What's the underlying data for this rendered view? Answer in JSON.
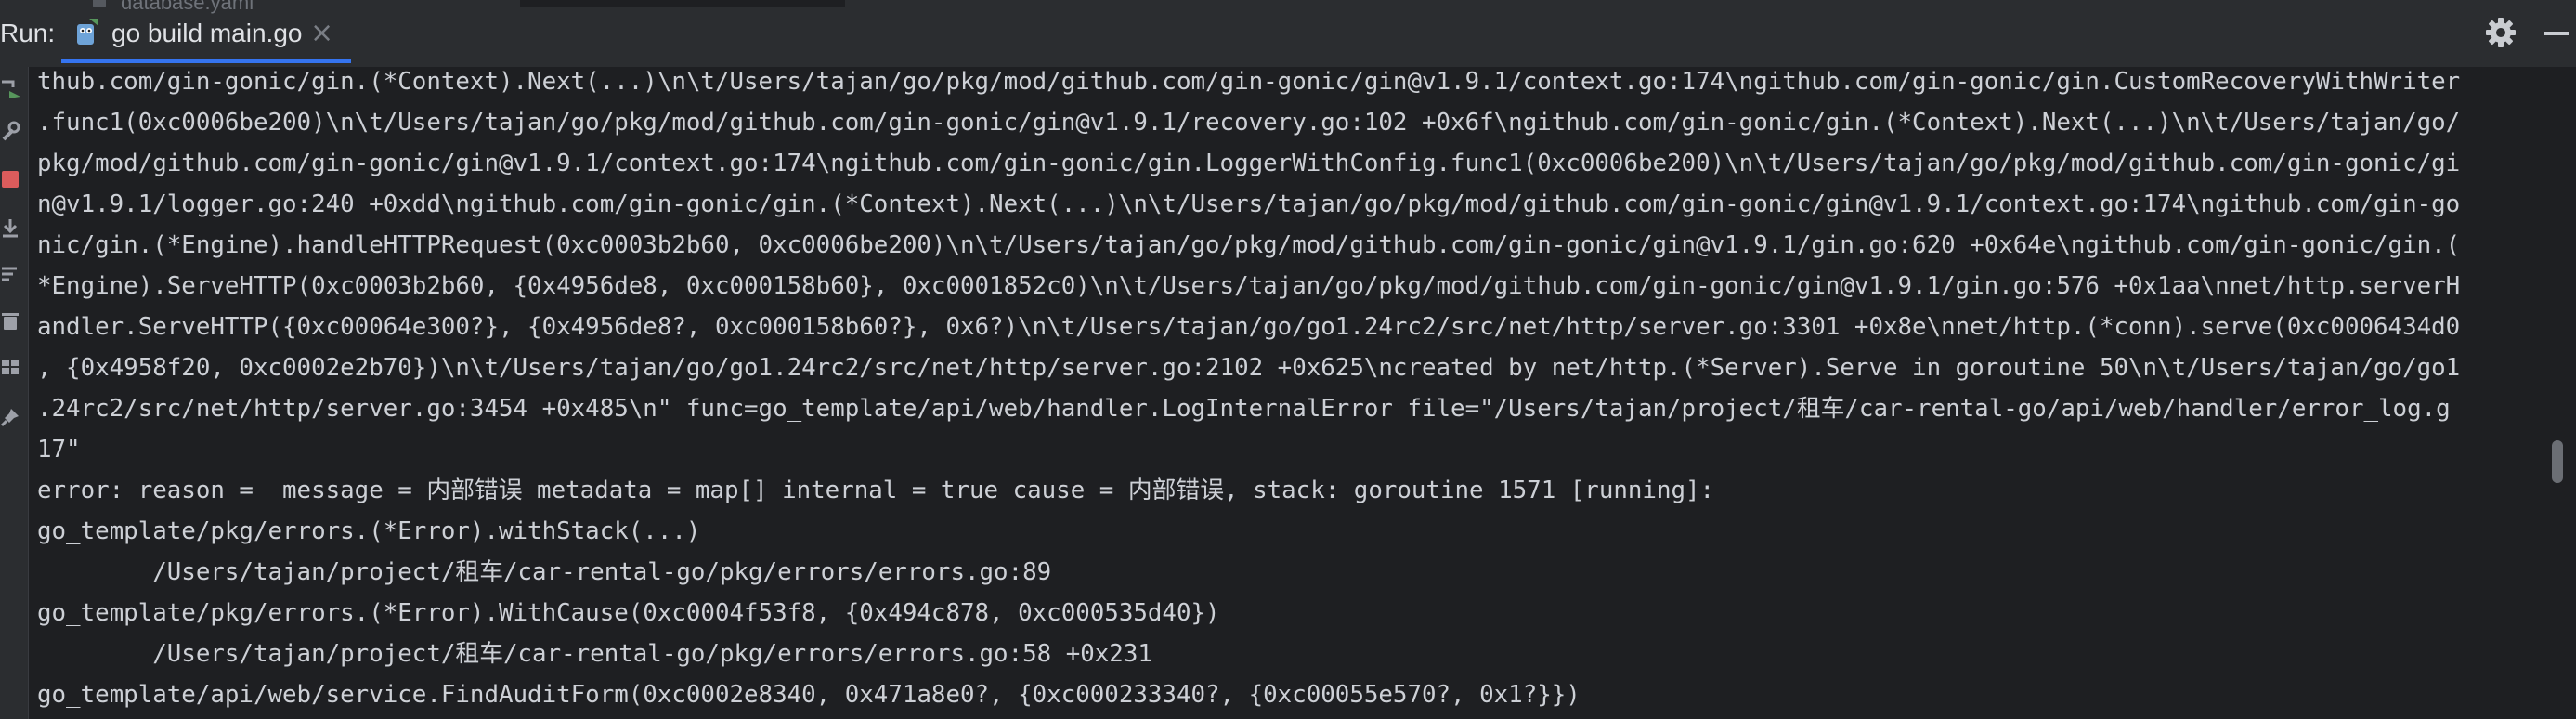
{
  "toolbar": {
    "run_label": "Run:",
    "tab_label": "go build main.go",
    "tab_close": "×",
    "background_file": "database.yaml"
  },
  "icons": {
    "tab": "go-file-icon",
    "settings": "gear-icon",
    "minimize": "minimize-icon",
    "sidebar": [
      "rerun-icon",
      "settings-wrench-icon",
      "stop-icon",
      "scroll-to-end-icon",
      "soft-wrap-icon",
      "delete-icon",
      "layout-icon",
      "pin-icon"
    ]
  },
  "colors": {
    "background": "#1e1f22",
    "toolbar": "#2b2d30",
    "text": "#cdd0d6",
    "tab_underline": "#3574f0",
    "run_icon": "#57965c",
    "stop_icon": "#db5c5c"
  },
  "console": {
    "lines": [
      "thub.com/gin-gonic/gin.(*Context).Next(...)\\n\\t/Users/tajan/go/pkg/mod/github.com/gin-gonic/gin@v1.9.1/context.go:174\\ngithub.com/gin-gonic/gin.CustomRecoveryWithWriter",
      ".func1(0xc0006be200)\\n\\t/Users/tajan/go/pkg/mod/github.com/gin-gonic/gin@v1.9.1/recovery.go:102 +0x6f\\ngithub.com/gin-gonic/gin.(*Context).Next(...)\\n\\t/Users/tajan/go/",
      "pkg/mod/github.com/gin-gonic/gin@v1.9.1/context.go:174\\ngithub.com/gin-gonic/gin.LoggerWithConfig.func1(0xc0006be200)\\n\\t/Users/tajan/go/pkg/mod/github.com/gin-gonic/gi",
      "n@v1.9.1/logger.go:240 +0xdd\\ngithub.com/gin-gonic/gin.(*Context).Next(...)\\n\\t/Users/tajan/go/pkg/mod/github.com/gin-gonic/gin@v1.9.1/context.go:174\\ngithub.com/gin-go",
      "nic/gin.(*Engine).handleHTTPRequest(0xc0003b2b60, 0xc0006be200)\\n\\t/Users/tajan/go/pkg/mod/github.com/gin-gonic/gin@v1.9.1/gin.go:620 +0x64e\\ngithub.com/gin-gonic/gin.(",
      "*Engine).ServeHTTP(0xc0003b2b60, {0x4956de8, 0xc000158b60}, 0xc0001852c0)\\n\\t/Users/tajan/go/pkg/mod/github.com/gin-gonic/gin@v1.9.1/gin.go:576 +0x1aa\\nnet/http.serverH",
      "andler.ServeHTTP({0xc00064e300?}, {0x4956de8?, 0xc000158b60?}, 0x6?)\\n\\t/Users/tajan/go/go1.24rc2/src/net/http/server.go:3301 +0x8e\\nnet/http.(*conn).serve(0xc0006434d0",
      ", {0x4958f20, 0xc0002e2b70})\\n\\t/Users/tajan/go/go1.24rc2/src/net/http/server.go:2102 +0x625\\ncreated by net/http.(*Server).Serve in goroutine 50\\n\\t/Users/tajan/go/go1",
      ".24rc2/src/net/http/server.go:3454 +0x485\\n\" func=go_template/api/web/handler.LogInternalError file=\"/Users/tajan/project/租车/car-rental-go/api/web/handler/error_log.g",
      "17\"",
      "error: reason =  message = 内部错误 metadata = map[] internal = true cause = 内部错误, stack: goroutine 1571 [running]:",
      "go_template/pkg/errors.(*Error).withStack(...)",
      "        /Users/tajan/project/租车/car-rental-go/pkg/errors/errors.go:89",
      "go_template/pkg/errors.(*Error).WithCause(0xc0004f53f8, {0x494c878, 0xc000535d40})",
      "        /Users/tajan/project/租车/car-rental-go/pkg/errors/errors.go:58 +0x231",
      "go_template/api/web/service.FindAuditForm(0xc0002e8340, 0x471a8e0?, {0xc000233340?, {0xc00055e570?, 0x1?}})"
    ]
  }
}
